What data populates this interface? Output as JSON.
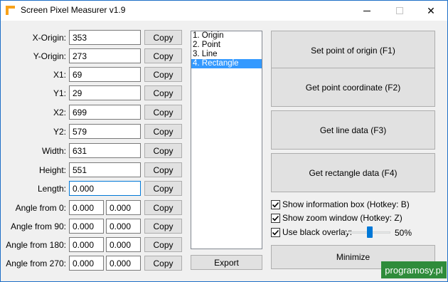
{
  "window": {
    "title": "Screen Pixel Measurer v1.9"
  },
  "fields": {
    "x_origin": {
      "label": "X-Origin:",
      "value": "353"
    },
    "y_origin": {
      "label": "Y-Origin:",
      "value": "273"
    },
    "x1": {
      "label": "X1:",
      "value": "69"
    },
    "y1": {
      "label": "Y1:",
      "value": "29"
    },
    "x2": {
      "label": "X2:",
      "value": "699"
    },
    "y2": {
      "label": "Y2:",
      "value": "579"
    },
    "width": {
      "label": "Width:",
      "value": "631"
    },
    "height": {
      "label": "Height:",
      "value": "551"
    },
    "length": {
      "label": "Length:",
      "value": "0.000"
    }
  },
  "angles": [
    {
      "label": "Angle from 0:",
      "a": "0.000",
      "b": "0.000"
    },
    {
      "label": "Angle from 90:",
      "a": "0.000",
      "b": "0.000"
    },
    {
      "label": "Angle from 180:",
      "a": "0.000",
      "b": "0.000"
    },
    {
      "label": "Angle from 270:",
      "a": "0.000",
      "b": "0.000"
    }
  ],
  "copy_label": "Copy",
  "list": {
    "items": [
      "1. Origin",
      "2. Point",
      "3. Line",
      "4. Rectangle"
    ],
    "selected": "4. Rectangle"
  },
  "export_label": "Export",
  "actions": {
    "set_origin": "Set point of origin (F1)",
    "get_point": "Get point coordinate (F2)",
    "get_line": "Get line data (F3)",
    "get_rect": "Get rectangle data (F4)",
    "minimize": "Minimize"
  },
  "options": {
    "info_box": {
      "label": "Show information box (Hotkey: B)",
      "checked": true
    },
    "zoom_window": {
      "label": "Show zoom window (Hotkey: Z)",
      "checked": true
    },
    "black_overlay": {
      "label": "Use black overlay:",
      "checked": true
    }
  },
  "overlay_slider": {
    "value": 50,
    "display": "50%"
  },
  "watermark": "programosy.pl",
  "colors": {
    "accent": "#0078d7",
    "selection": "#3399ff",
    "watermark_bg": "#2f8c3b",
    "icon": "#f7a21b"
  }
}
